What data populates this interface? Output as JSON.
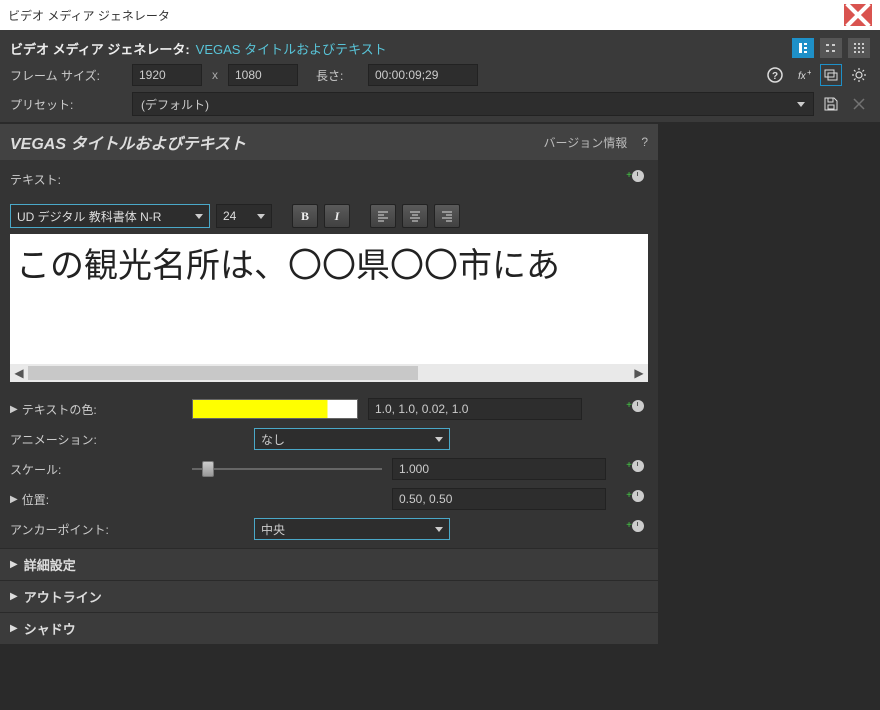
{
  "titlebar": {
    "title": "ビデオ メディア ジェネレータ"
  },
  "header": {
    "label": "ビデオ メディア ジェネレータ:",
    "plugin": "VEGAS タイトルおよびテキスト"
  },
  "frame": {
    "label": "フレーム サイズ:",
    "width": "1920",
    "x": "x",
    "height": "1080",
    "length_label": "長さ:",
    "length": "00:00:09;29"
  },
  "preset": {
    "label": "プリセット:",
    "value": "(デフォルト)"
  },
  "panel": {
    "title": "VEGAS タイトルおよびテキスト",
    "version": "バージョン情報",
    "help": "?"
  },
  "text": {
    "label": "テキスト:",
    "font": "UD デジタル 教科書体 N-R",
    "size": "24",
    "content": "この観光名所は、〇〇県〇〇市にあ"
  },
  "props": {
    "color_label": "テキストの色:",
    "color_value": "1.0, 1.0, 0.02, 1.0",
    "anim_label": "アニメーション:",
    "anim_value": "なし",
    "scale_label": "スケール:",
    "scale_value": "1.000",
    "pos_label": "位置:",
    "pos_value": "0.50, 0.50",
    "anchor_label": "アンカーポイント:",
    "anchor_value": "中央"
  },
  "groups": {
    "advanced": "詳細設定",
    "outline": "アウトライン",
    "shadow": "シャドウ"
  }
}
